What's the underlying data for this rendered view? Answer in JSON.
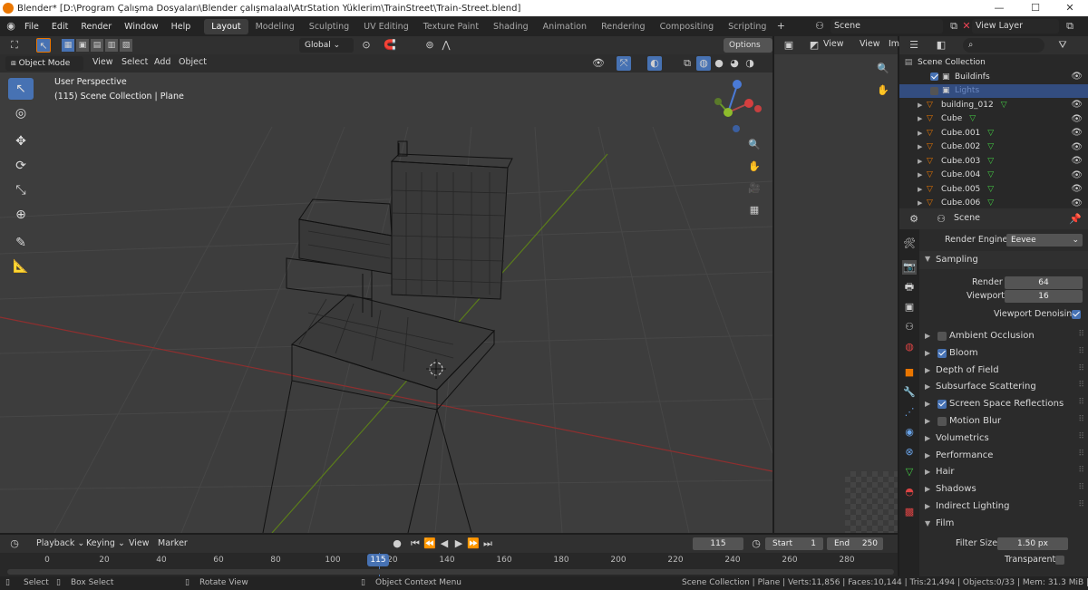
{
  "titlebar": {
    "title": "Blender* [D:\\Program Çalışma Dosyaları\\Blender çalışmalaal\\AtrStation Yüklerim\\TrainStreet\\Train-Street.blend]",
    "min": "—",
    "max": "☐",
    "close": "✕"
  },
  "menu": [
    "File",
    "Edit",
    "Render",
    "Window",
    "Help"
  ],
  "workspaces": [
    "Layout",
    "Modeling",
    "Sculpting",
    "UV Editing",
    "Texture Paint",
    "Shading",
    "Animation",
    "Rendering",
    "Compositing",
    "Scripting"
  ],
  "scene_name": "Scene",
  "view_layer": "View Layer",
  "viewport": {
    "transform": "Global",
    "options": "Options",
    "mode": "Object Mode",
    "menus": [
      "View",
      "Select",
      "Add",
      "Object"
    ],
    "overlay_line1": "User Perspective",
    "overlay_line2": "(115) Scene Collection | Plane"
  },
  "image_editor": {
    "menus": [
      "View",
      "Im"
    ]
  },
  "outliner": {
    "root": "Scene Collection",
    "items": [
      {
        "name": "Buildinfs",
        "type": "collection"
      },
      {
        "name": "Lights",
        "type": "collection",
        "selected": true
      },
      {
        "name": "building_012",
        "type": "mesh"
      },
      {
        "name": "Cube",
        "type": "mesh"
      },
      {
        "name": "Cube.001",
        "type": "mesh"
      },
      {
        "name": "Cube.002",
        "type": "mesh"
      },
      {
        "name": "Cube.003",
        "type": "mesh"
      },
      {
        "name": "Cube.004",
        "type": "mesh"
      },
      {
        "name": "Cube.005",
        "type": "mesh"
      },
      {
        "name": "Cube.006",
        "type": "mesh"
      }
    ]
  },
  "properties": {
    "scene": "Scene",
    "render_engine_label": "Render Engine",
    "render_engine": "Eevee",
    "sampling": "Sampling",
    "render_label": "Render",
    "render_value": "64",
    "viewport_label": "Viewport",
    "viewport_value": "16",
    "viewport_denoising": "Viewport Denoising",
    "panels": [
      {
        "label": "Ambient Occlusion",
        "check": false
      },
      {
        "label": "Bloom",
        "check": true
      },
      {
        "label": "Depth of Field"
      },
      {
        "label": "Subsurface Scattering"
      },
      {
        "label": "Screen Space Reflections",
        "check": true
      },
      {
        "label": "Motion Blur",
        "check": false
      },
      {
        "label": "Volumetrics"
      },
      {
        "label": "Performance"
      },
      {
        "label": "Hair"
      },
      {
        "label": "Shadows"
      },
      {
        "label": "Indirect Lighting"
      }
    ],
    "film": "Film",
    "filter_size_label": "Filter Size",
    "filter_size": "1.50 px",
    "transparent_label": "Transparent"
  },
  "timeline": {
    "menus": [
      "Playback",
      "Keying",
      "View",
      "Marker"
    ],
    "current_frame": "115",
    "start_label": "Start",
    "start": "1",
    "end_label": "End",
    "end": "250",
    "ticks": [
      "0",
      "20",
      "40",
      "60",
      "80",
      "100",
      "120",
      "140",
      "160",
      "180",
      "200",
      "220",
      "240",
      "260",
      "280"
    ]
  },
  "status": {
    "select": "Select",
    "box_select": "Box Select",
    "rotate_view": "Rotate View",
    "context_menu": "Object Context Menu",
    "stats": "Scene Collection | Plane | Verts:11,856 | Faces:10,144 | Tris:21,494 | Objects:0/33 | Mem: 31.3 MiB | 2.83.7"
  },
  "colors": {
    "accent": "#4772b3",
    "selected_row": "#334d80",
    "x_axis": "#a83232",
    "y_axis": "#6b9a1e",
    "orange": "#ea7600"
  }
}
